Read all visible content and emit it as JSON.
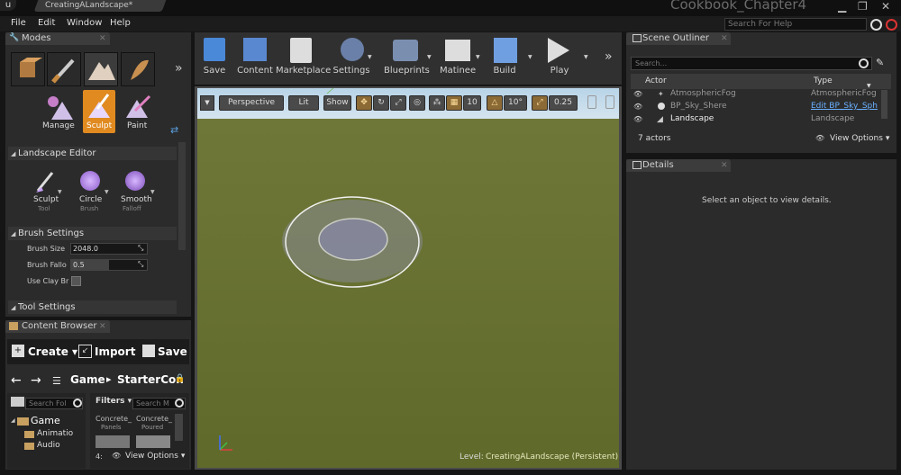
{
  "doc_tab": "CreatingALandscape*",
  "project_name": "Cookbook_Chapter4",
  "menu": [
    "File",
    "Edit",
    "Window",
    "Help"
  ],
  "help_search_placeholder": "Search For Help",
  "modes": {
    "title": "Modes",
    "items": [
      "Manage",
      "Sculpt",
      "Paint"
    ]
  },
  "landscape_editor": {
    "title": "Landscape Editor",
    "tools": [
      {
        "label": "Sculpt",
        "sub": "Tool"
      },
      {
        "label": "Circle",
        "sub": "Brush"
      },
      {
        "label": "Smooth",
        "sub": "Falloff"
      }
    ]
  },
  "brush_settings": {
    "title": "Brush Settings",
    "size_label": "Brush Size",
    "size_value": "2048.0",
    "falloff_label": "Brush Fallo",
    "falloff_value": "0.5",
    "clay_label": "Use Clay Br"
  },
  "tool_settings_title": "Tool Settings",
  "content_browser": {
    "title": "Content Browser",
    "create": "Create",
    "import": "Import",
    "save": "Save",
    "path": [
      "Game",
      "StarterCon"
    ],
    "search_folders": "Search Fol",
    "filters": "Filters",
    "search_assets": "Search M",
    "folders": [
      "Game",
      "Animatio",
      "Audio"
    ],
    "assets": [
      {
        "name": "Concrete_",
        "sub": "Panels"
      },
      {
        "name": "Concrete_",
        "sub": "Poured"
      }
    ],
    "count": "4:",
    "view_options": "View Options"
  },
  "toolbar": [
    "Save",
    "Content",
    "Marketplace",
    "Settings",
    "Blueprints",
    "Matinee",
    "Build",
    "Play"
  ],
  "viewport": {
    "perspective": "Perspective",
    "lit": "Lit",
    "show": "Show",
    "grid": "10",
    "angle": "10°",
    "scale": "0.25",
    "level_label": "Level:",
    "level_name": "CreatingALandscape (Persistent)"
  },
  "outliner": {
    "title": "Scene Outliner",
    "search": "Search...",
    "col_actor": "Actor",
    "col_type": "Type",
    "rows": [
      {
        "actor": "AtmosphericFog",
        "type": "AtmosphericFog"
      },
      {
        "actor": "BP_Sky_Shere",
        "type": "Edit BP_Sky_Sph"
      },
      {
        "actor": "Landscape",
        "type": "Landscape"
      }
    ],
    "count": "7 actors",
    "view_options": "View Options"
  },
  "details": {
    "title": "Details",
    "empty_msg": "Select an object to view details."
  }
}
